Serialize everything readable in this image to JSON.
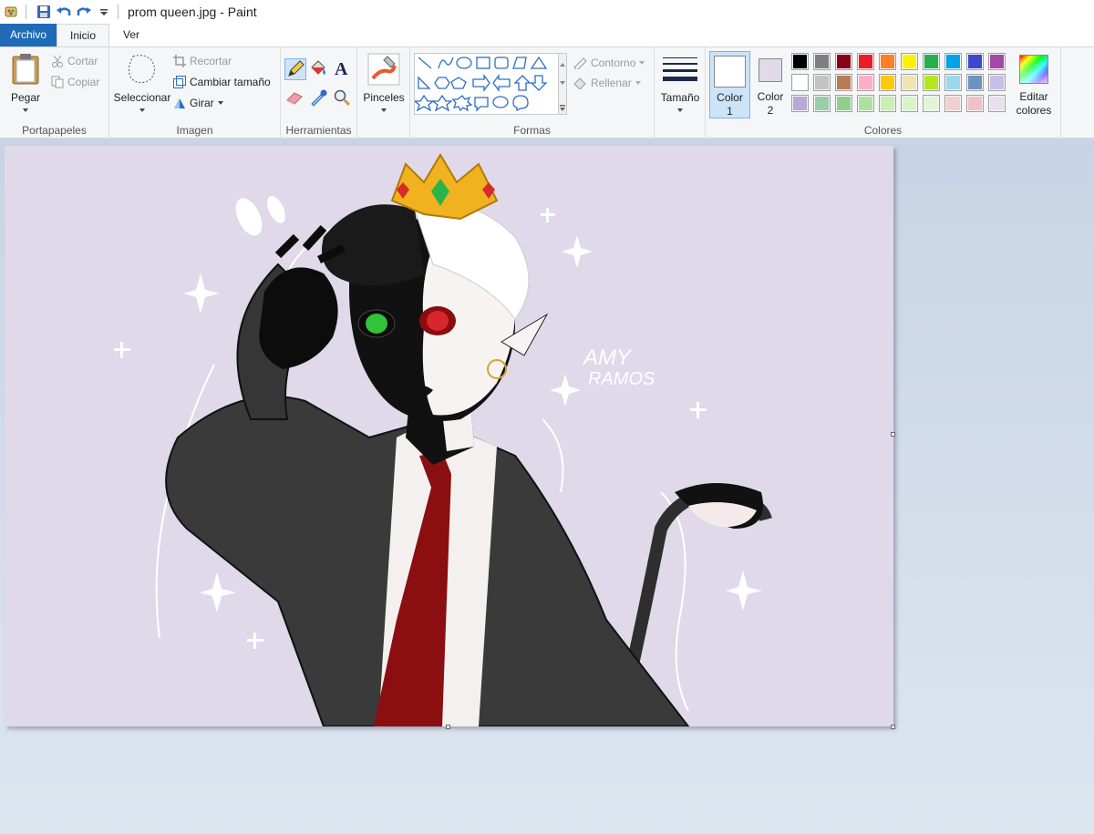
{
  "window": {
    "title": "prom queen.jpg - Paint"
  },
  "quick_access": {
    "icons": [
      "paint-app-icon",
      "save-icon",
      "undo-icon",
      "redo-icon",
      "customize-dropdown-icon"
    ]
  },
  "tabs": [
    {
      "label": "Archivo"
    },
    {
      "label": "Inicio"
    },
    {
      "label": "Ver"
    }
  ],
  "clipboard": {
    "paste": "Pegar",
    "cut": "Cortar",
    "copy": "Copiar",
    "group": "Portapapeles"
  },
  "image": {
    "select": "Seleccionar",
    "crop": "Recortar",
    "resize": "Cambiar tamaño",
    "rotate": "Girar",
    "group": "Imagen"
  },
  "tools": {
    "group": "Herramientas"
  },
  "brushes": {
    "label": "Pinceles"
  },
  "shapes": {
    "outline": "Contorno",
    "fill": "Rellenar",
    "group": "Formas"
  },
  "size": {
    "label": "Tamaño"
  },
  "colors": {
    "color1_label": "Color",
    "color1_num": "1",
    "color2_label": "Color",
    "color2_num": "2",
    "edit": "Editar",
    "edit2": "colores",
    "group": "Colores",
    "color1_value": "#ffffff",
    "color2_value": "#e0d9e9",
    "palette_row1": [
      "#000000",
      "#7f7f7f",
      "#880015",
      "#ed1c24",
      "#ff7f27",
      "#fff200",
      "#22b14c",
      "#00a2e8",
      "#3f48cc",
      "#a349a4"
    ],
    "palette_row2": [
      "#ffffff",
      "#c3c3c3",
      "#b97a57",
      "#ffaec9",
      "#ffc90e",
      "#efe4b0",
      "#b5e61d",
      "#99d9ea",
      "#7092be",
      "#c8bfe7"
    ],
    "palette_row3": [
      "#b8a9d6",
      "#99cfa8",
      "#8fd18c",
      "#b0e0a0",
      "#c8f0b0",
      "#d8f5c8",
      "#e0f5d8",
      "#f0d0d0",
      "#f0c0c8",
      "#e8e0f0"
    ]
  },
  "artwork": {
    "signature_line1": "AMY",
    "signature_line2": "RAMOS"
  }
}
